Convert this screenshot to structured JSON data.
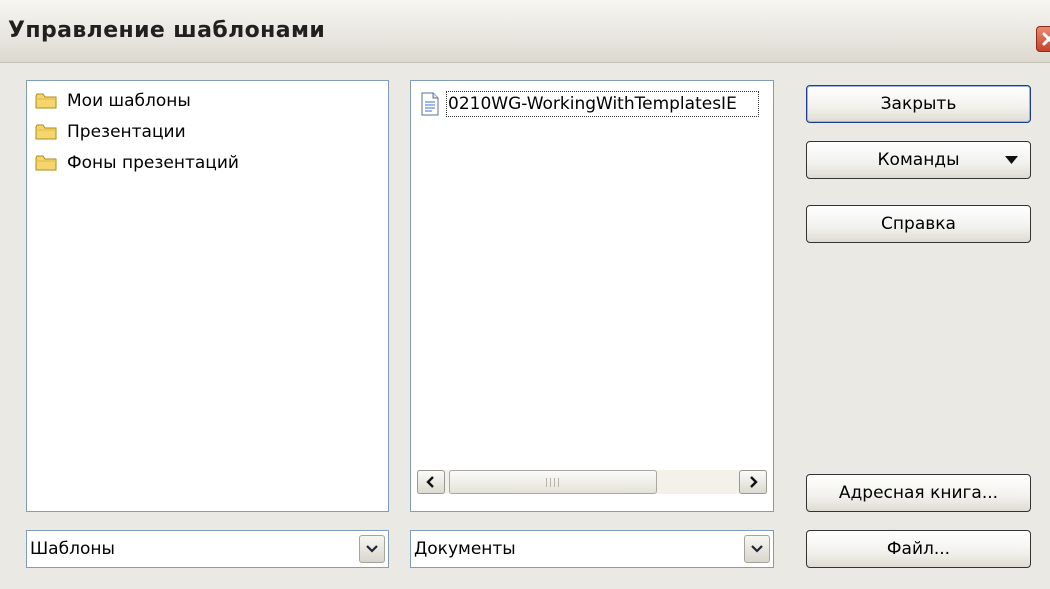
{
  "window": {
    "title": "Управление шаблонами"
  },
  "categories": {
    "items": [
      {
        "label": "Мои шаблоны"
      },
      {
        "label": "Презентации"
      },
      {
        "label": "Фоны презентаций"
      }
    ]
  },
  "documents": {
    "items": [
      {
        "label": "0210WG-WorkingWithTemplatesIE"
      }
    ]
  },
  "source_left": {
    "value": "Шаблоны"
  },
  "source_right": {
    "value": "Документы"
  },
  "buttons": {
    "close": "Закрыть",
    "commands": "Команды",
    "help": "Справка",
    "address_book": "Адресная книга...",
    "file": "Файл..."
  },
  "icons": {
    "folder": "folder-icon",
    "document": "document-icon",
    "dropdown": "chevron-down-icon",
    "scroll_left": "scroll-left-icon",
    "scroll_right": "scroll-right-icon",
    "window_close": "close-icon"
  },
  "colors": {
    "dialog_bg": "#ebe9e4",
    "panel_border": "#7f9db9",
    "default_button_border": "#1d3d8a",
    "close_button": "#c6432a",
    "folder": "#f4d66c"
  }
}
